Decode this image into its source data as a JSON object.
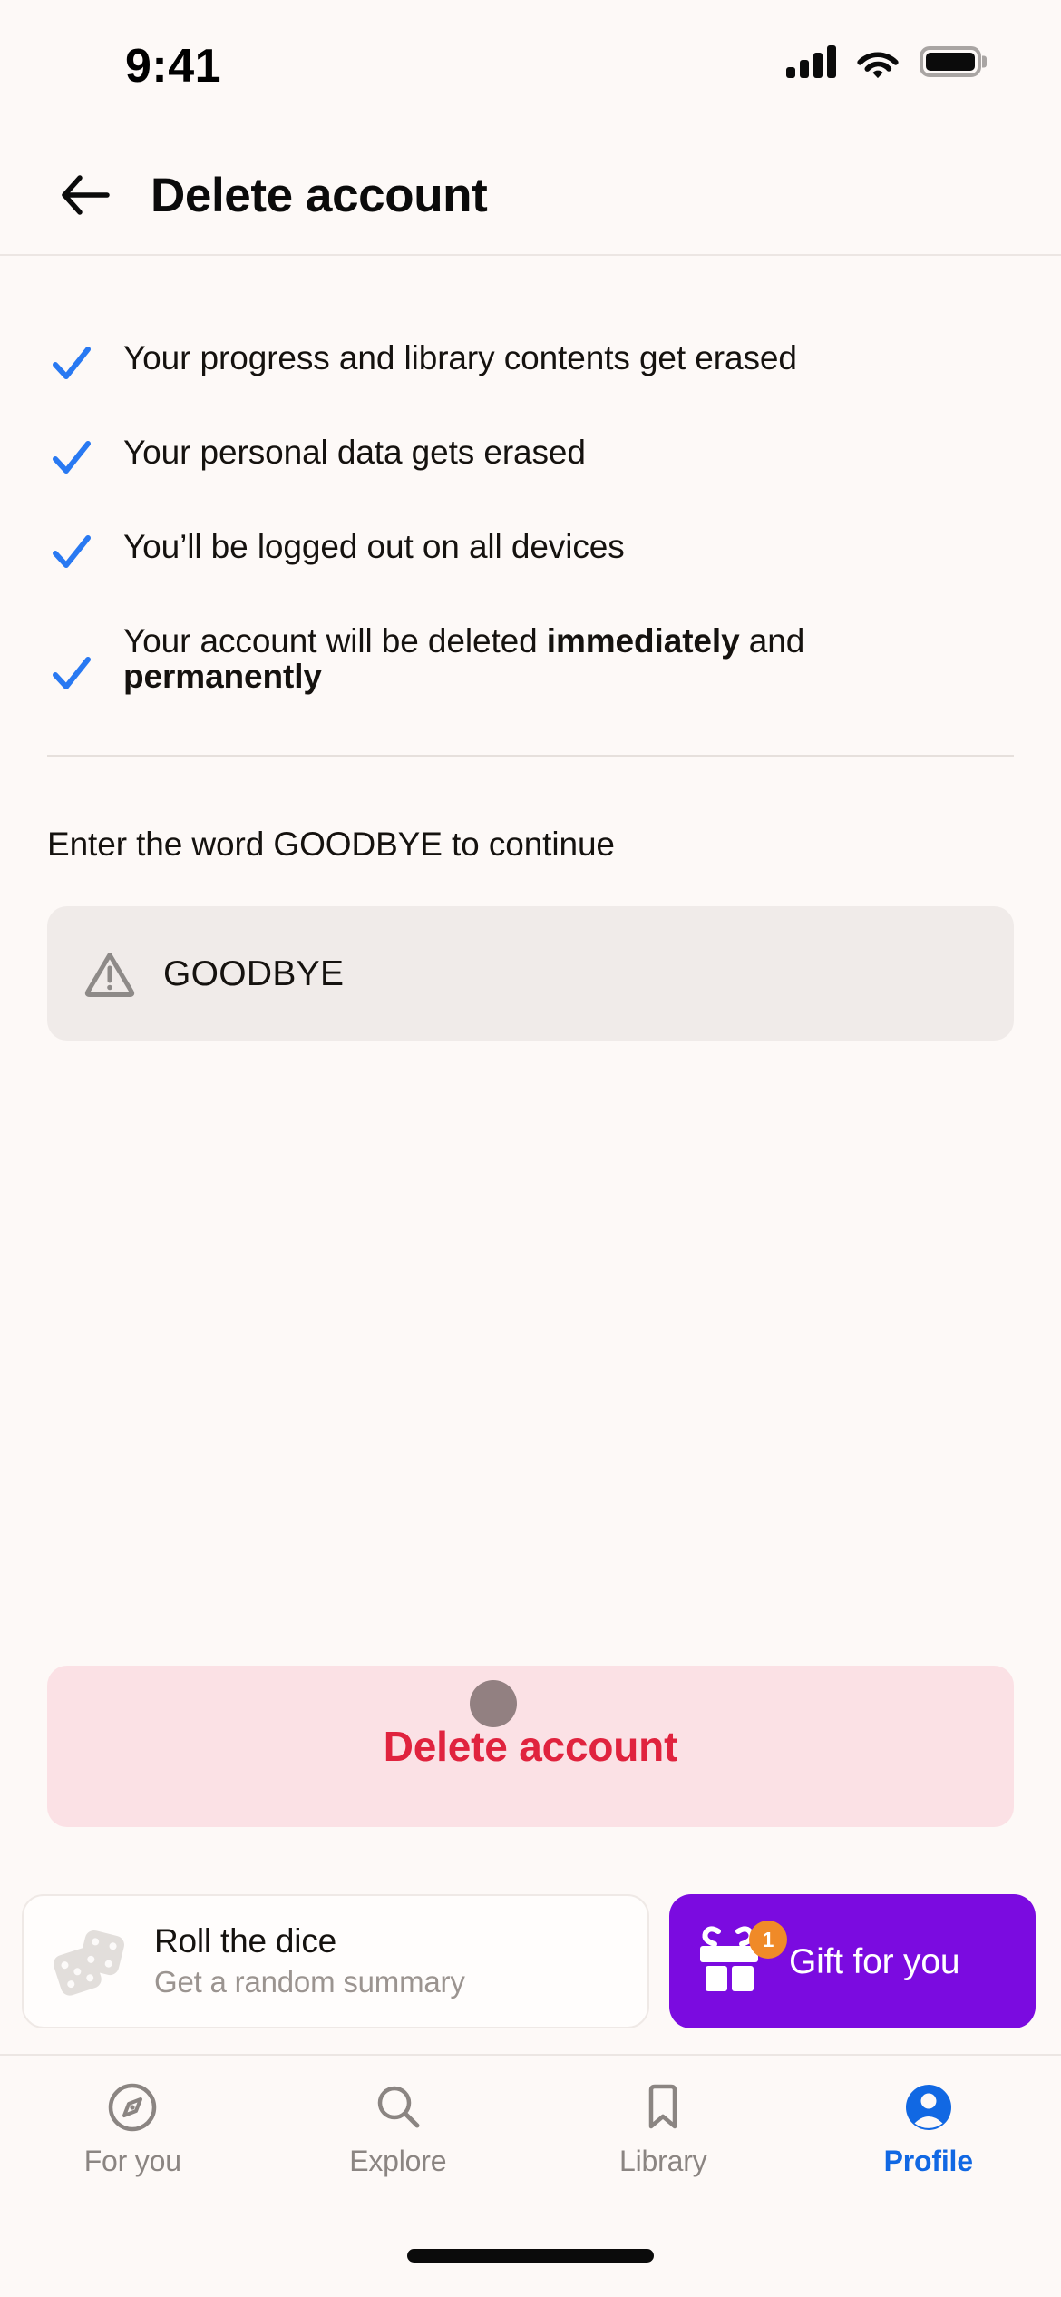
{
  "status_bar": {
    "time": "9:41",
    "signal_icon": "cellular-signal-icon",
    "wifi_icon": "wifi-icon",
    "battery_icon": "battery-full-icon"
  },
  "header": {
    "back_icon": "back-arrow-icon",
    "title": "Delete account"
  },
  "checklist": {
    "items": [
      {
        "icon": "check-icon",
        "text": "Your progress and library contents get erased",
        "bold_parts": []
      },
      {
        "icon": "check-icon",
        "text": "Your personal data gets erased",
        "bold_parts": []
      },
      {
        "icon": "check-icon",
        "text": "You’ll be logged out on all devices",
        "bold_parts": []
      },
      {
        "icon": "check-icon",
        "text_before": "Your account will be deleted ",
        "bold_1": "immediately",
        "text_middle": " and ",
        "bold_2": "permanently"
      }
    ]
  },
  "confirm": {
    "label": "Enter the word GOODBYE to continue",
    "input": {
      "icon": "warning-triangle-icon",
      "value": "GOODBYE",
      "placeholder": "GOODBYE"
    }
  },
  "primary_action": {
    "label": "Delete account"
  },
  "promos": {
    "dice": {
      "icon": "dice-icon",
      "title": "Roll the dice",
      "subtitle": "Get a random summary"
    },
    "gift": {
      "icon": "gift-icon",
      "badge": "1",
      "label": "Gift for you"
    }
  },
  "tabbar": {
    "items": [
      {
        "icon": "compass-icon",
        "label": "For you",
        "active": false
      },
      {
        "icon": "search-icon",
        "label": "Explore",
        "active": false
      },
      {
        "icon": "bookmark-icon",
        "label": "Library",
        "active": false
      },
      {
        "icon": "person-circle-icon",
        "label": "Profile",
        "active": true
      }
    ]
  },
  "colors": {
    "background": "#FDF9F7",
    "accent_blue": "#1168E3",
    "check_blue": "#2979F2",
    "danger_text": "#E0233E",
    "danger_bg": "#FBE1E5",
    "input_bg": "#F0EBE9",
    "gift_purple": "#7B0BE0",
    "badge_orange": "#F08A28",
    "muted_text": "#8B8582"
  }
}
